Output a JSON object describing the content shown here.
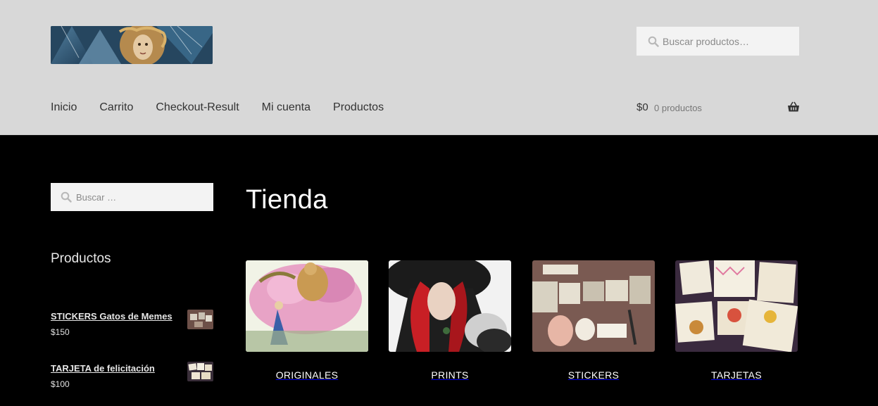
{
  "header": {
    "search_placeholder": "Buscar productos…",
    "nav": [
      "Inicio",
      "Carrito",
      "Checkout-Result",
      "Mi cuenta",
      "Productos"
    ],
    "cart": {
      "amount": "$0",
      "count": "0 productos"
    }
  },
  "sidebar": {
    "search_placeholder": "Buscar …",
    "widget_title": "Productos",
    "products": [
      {
        "name": "STICKERS Gatos de Memes",
        "price": "$150"
      },
      {
        "name": "TARJETA de felicitación",
        "price": "$100"
      }
    ]
  },
  "main": {
    "title": "Tienda",
    "categories": [
      {
        "label": "ORIGINALES"
      },
      {
        "label": "PRINTS"
      },
      {
        "label": "STICKERS"
      },
      {
        "label": "TARJETAS"
      }
    ]
  },
  "colors": {
    "header_bg": "#d8d8d8",
    "page_bg": "#000000",
    "search_bg": "#f3f3f3",
    "nav_text": "#333333"
  },
  "icons": [
    "search-icon",
    "basket-icon"
  ]
}
